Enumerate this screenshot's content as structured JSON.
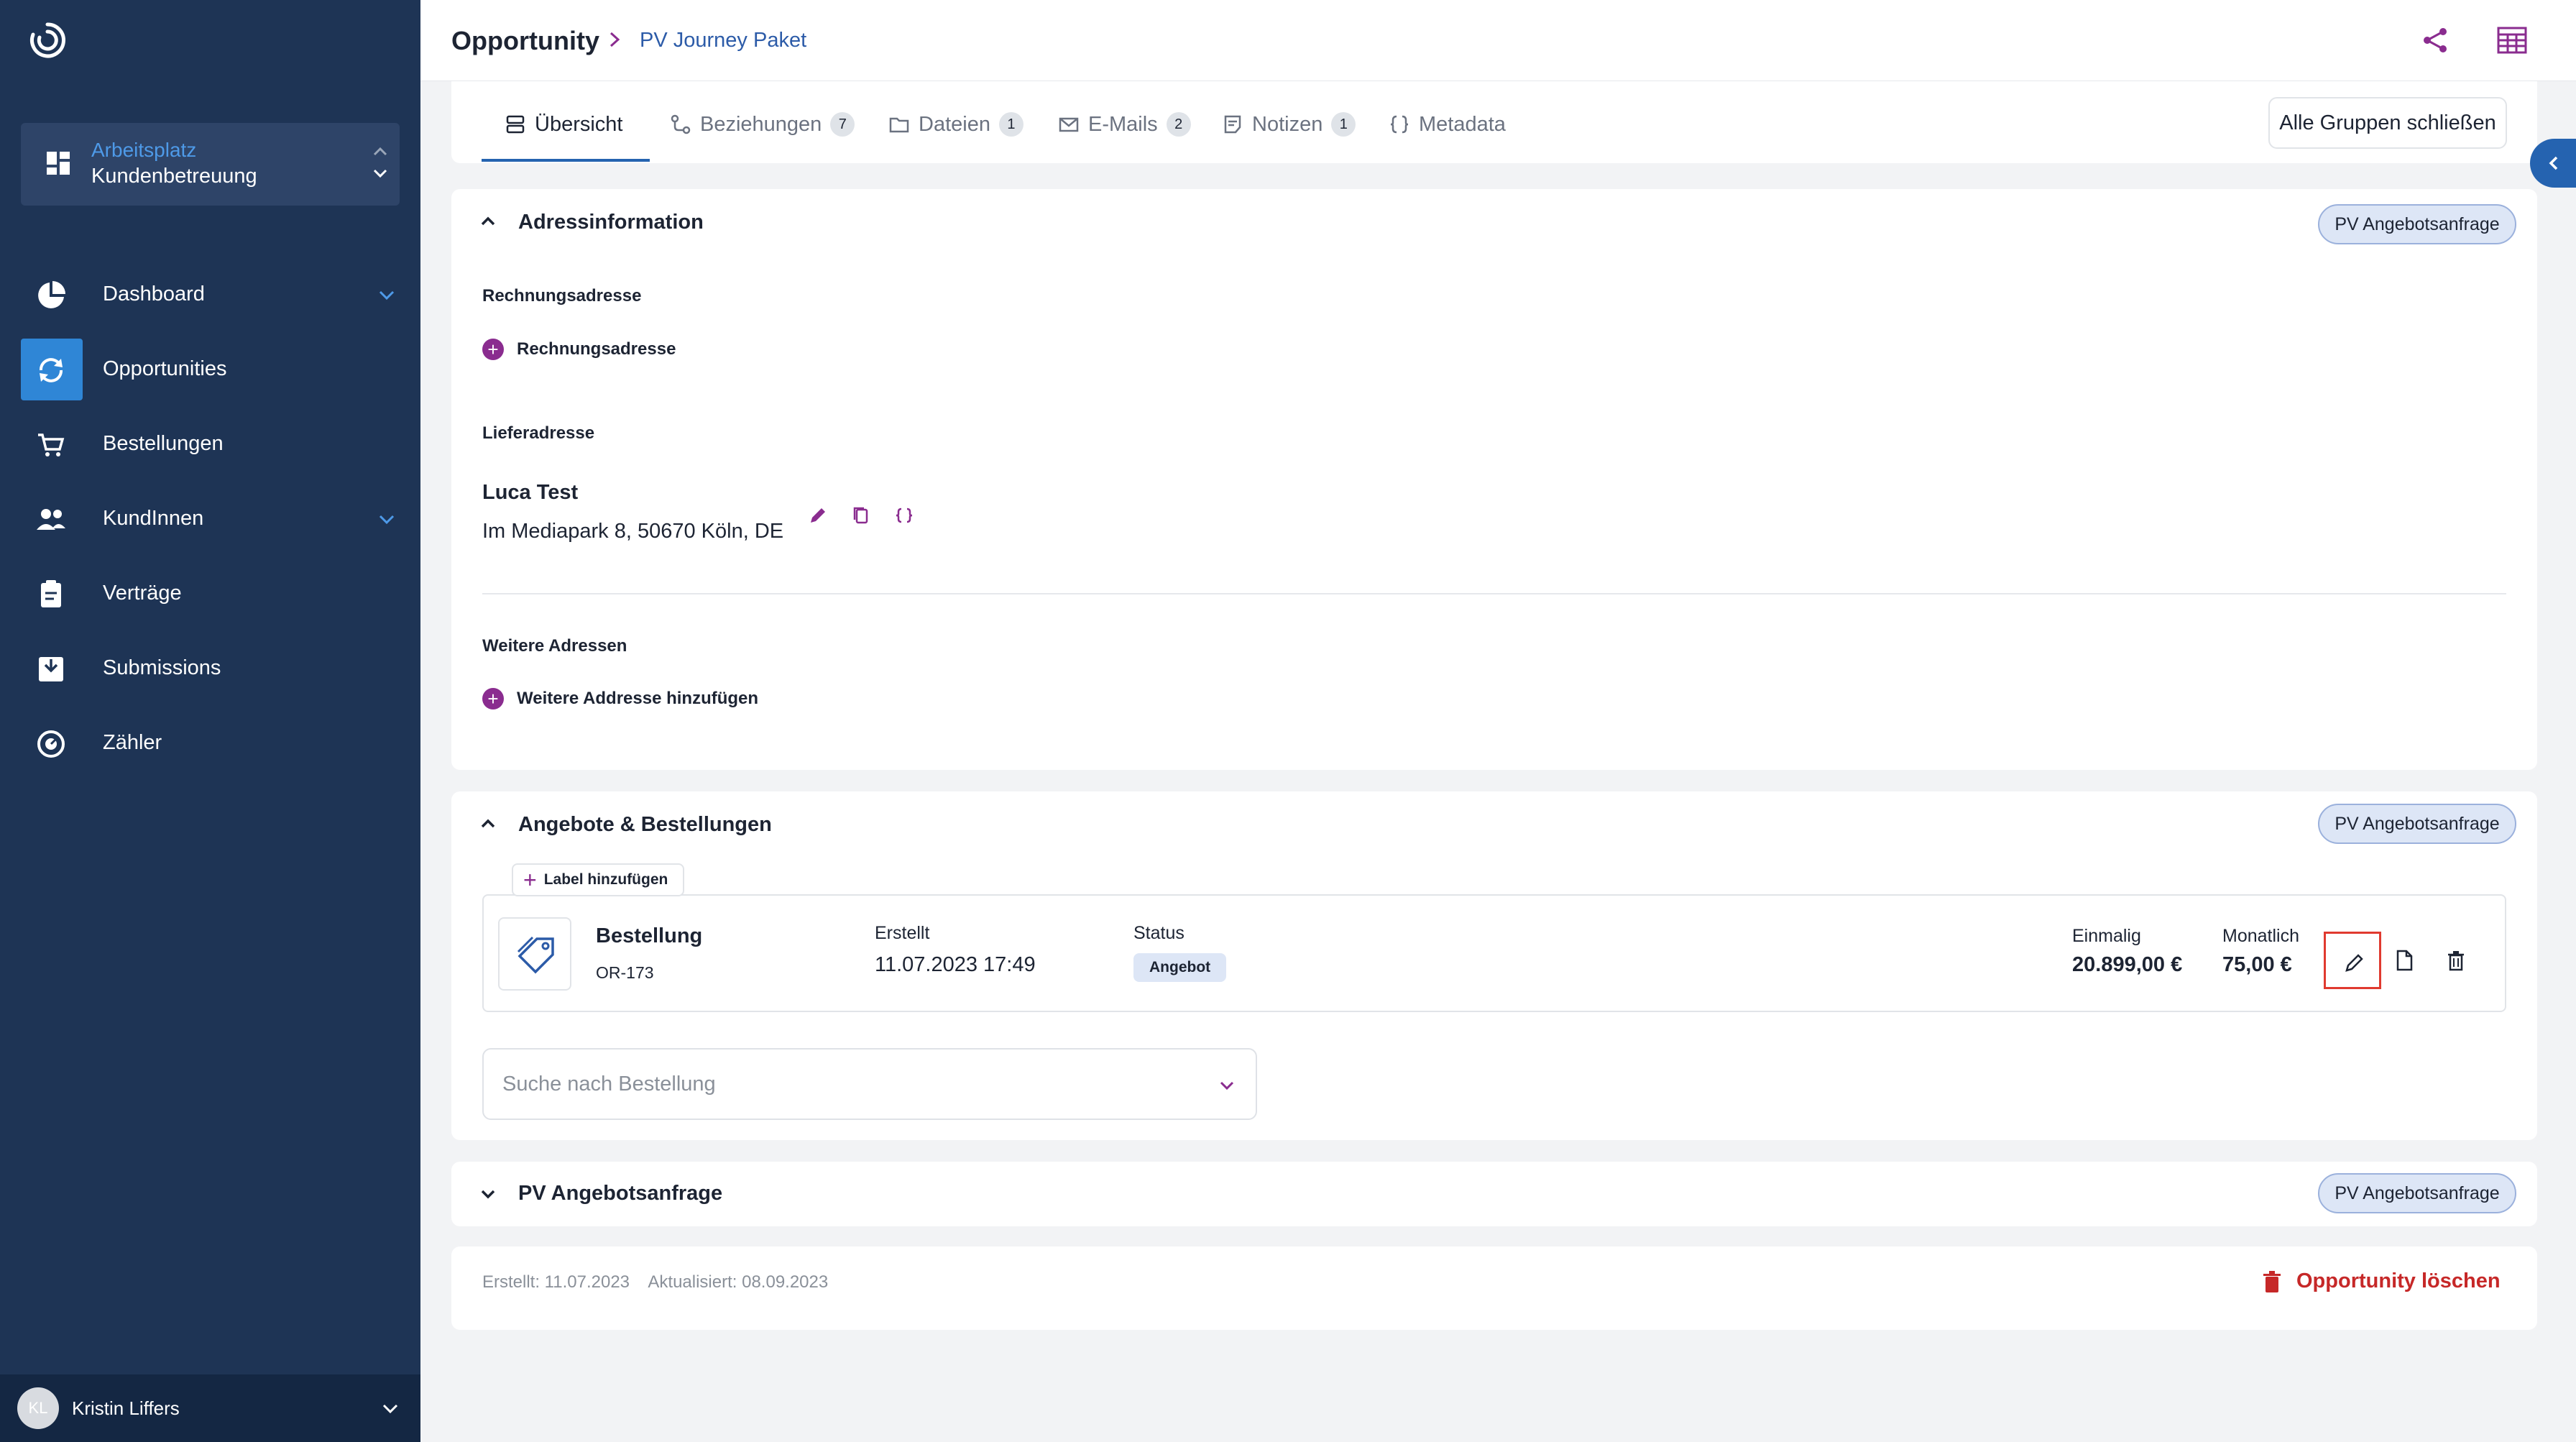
{
  "sidebar": {
    "workspace": {
      "title": "Arbeitsplatz",
      "subtitle": "Kundenbetreuung"
    },
    "items": [
      {
        "label": "Dashboard",
        "icon": "pie-chart-icon",
        "expandable": true
      },
      {
        "label": "Opportunities",
        "icon": "refresh-icon",
        "active": true
      },
      {
        "label": "Bestellungen",
        "icon": "cart-icon"
      },
      {
        "label": "KundInnen",
        "icon": "users-icon",
        "expandable": true
      },
      {
        "label": "Verträge",
        "icon": "clipboard-icon"
      },
      {
        "label": "Submissions",
        "icon": "inbox-icon"
      },
      {
        "label": "Zähler",
        "icon": "meter-icon"
      }
    ],
    "user": {
      "initials": "KL",
      "name": "Kristin Liffers"
    }
  },
  "header": {
    "breadcrumb": [
      "Opportunity",
      "PV Journey Paket"
    ]
  },
  "tabs": [
    {
      "label": "Übersicht",
      "active": true
    },
    {
      "label": "Beziehungen",
      "count": "7"
    },
    {
      "label": "Dateien",
      "count": "1"
    },
    {
      "label": "E-Mails",
      "count": "2"
    },
    {
      "label": "Notizen",
      "count": "1"
    },
    {
      "label": "Metadata"
    }
  ],
  "close_groups_label": "Alle Gruppen schließen",
  "address_section": {
    "title": "Adressinformation",
    "pill": "PV Angebotsanfrage",
    "billing_label": "Rechnungsadresse",
    "billing_add": "Rechnungsadresse",
    "delivery_label": "Lieferadresse",
    "delivery_name": "Luca Test",
    "delivery_address": "Im Mediapark 8, 50670 Köln, DE",
    "further_label": "Weitere Adressen",
    "further_add": "Weitere Addresse hinzufügen"
  },
  "orders_section": {
    "title": "Angebote & Bestellungen",
    "pill": "PV Angebotsanfrage",
    "add_label": "Label hinzufügen",
    "order": {
      "title": "Bestellung",
      "id": "OR-173",
      "created_label": "Erstellt",
      "created_value": "11.07.2023 17:49",
      "status_label": "Status",
      "status_value": "Angebot",
      "once_label": "Einmalig",
      "once_value": "20.899,00 €",
      "monthly_label": "Monatlich",
      "monthly_value": "75,00 €"
    },
    "search_placeholder": "Suche nach Bestellung"
  },
  "pv_section": {
    "title": "PV Angebotsanfrage",
    "pill": "PV Angebotsanfrage"
  },
  "footer": {
    "created": "Erstellt: 11.07.2023",
    "updated": "Aktualisiert: 08.09.2023",
    "delete_label": "Opportunity löschen"
  },
  "colors": {
    "sidebar_bg": "#1e3455",
    "accent_blue": "#2563b0",
    "accent_purple": "#8a2c8f",
    "danger": "#c62828",
    "highlight": "#e03a2f"
  }
}
